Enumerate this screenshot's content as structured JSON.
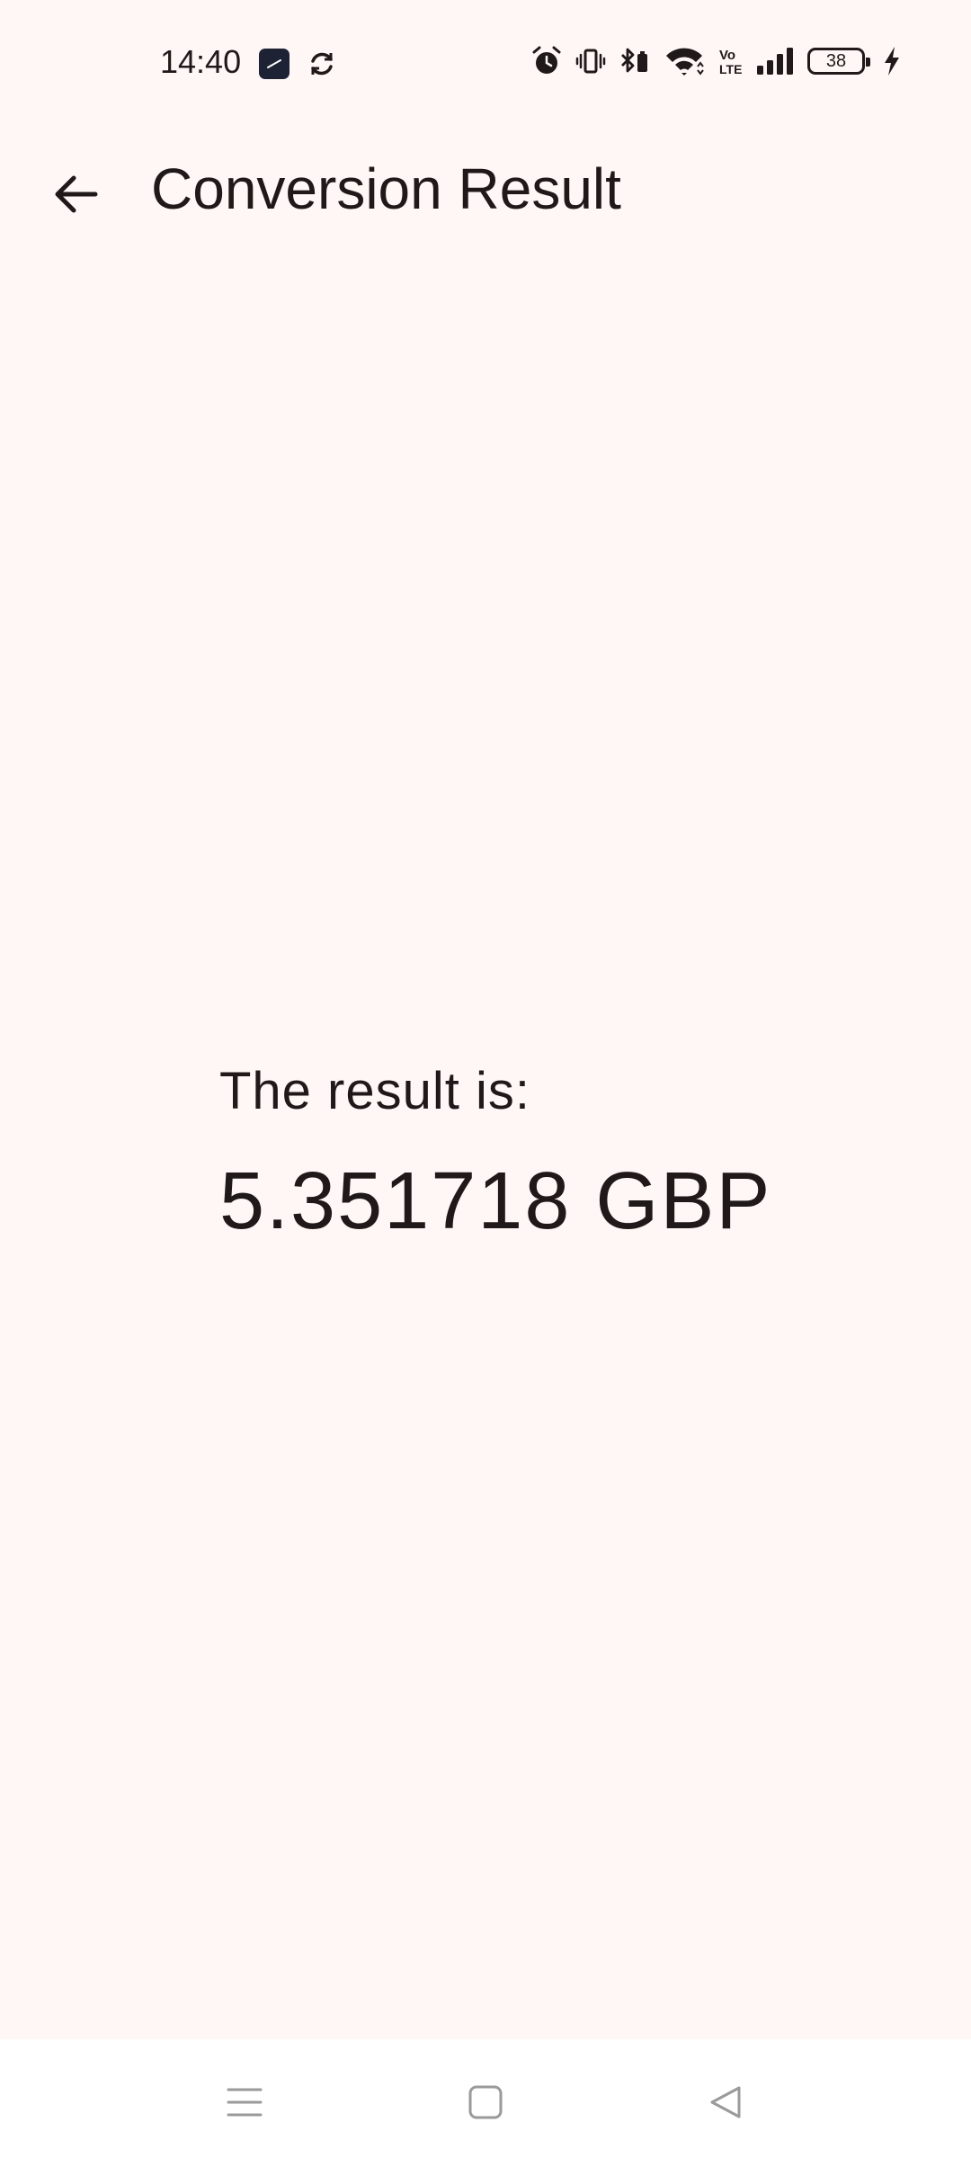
{
  "status_bar": {
    "time": "14:40",
    "battery_level": "38",
    "icons": [
      "clock-app-icon",
      "sync-icon",
      "alarm-icon",
      "vibrate-icon",
      "bluetooth-battery-icon",
      "wifi-icon",
      "volte-icon",
      "signal-icon",
      "battery-icon",
      "charging-icon"
    ]
  },
  "app_bar": {
    "title": "Conversion Result",
    "back_icon": "arrow-back-icon"
  },
  "content": {
    "label": "The result is:",
    "value": "5.351718 GBP"
  },
  "nav_bar": {
    "icons": [
      "menu-icon",
      "home-icon",
      "back-triangle-icon"
    ]
  },
  "colors": {
    "background": "#fff7f5",
    "text": "#1f1a19",
    "nav_background": "#ffffff",
    "nav_icon": "#9a9a9a"
  }
}
